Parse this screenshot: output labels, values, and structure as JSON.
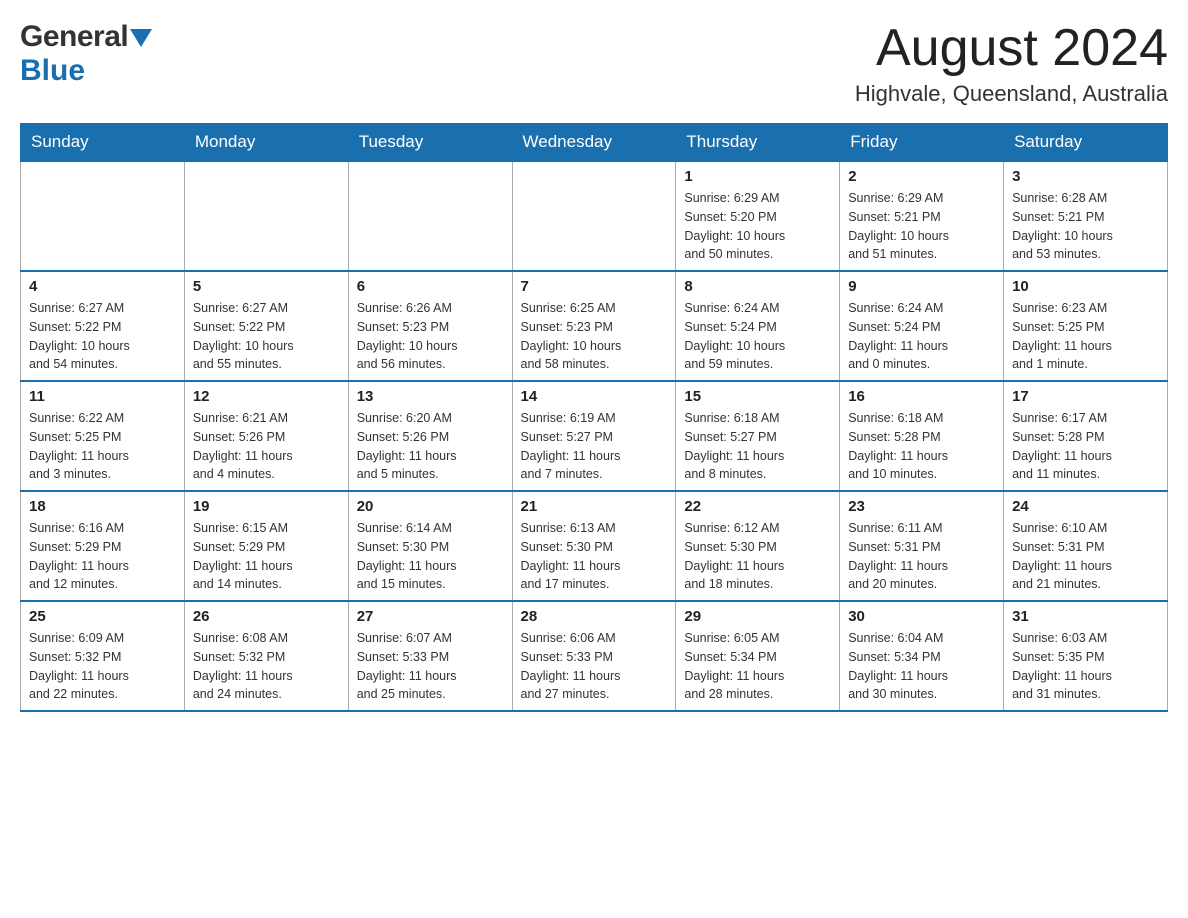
{
  "header": {
    "logo_general": "General",
    "logo_blue": "Blue",
    "month_title": "August 2024",
    "location": "Highvale, Queensland, Australia"
  },
  "days_of_week": [
    "Sunday",
    "Monday",
    "Tuesday",
    "Wednesday",
    "Thursday",
    "Friday",
    "Saturday"
  ],
  "weeks": [
    [
      {
        "day": "",
        "info": ""
      },
      {
        "day": "",
        "info": ""
      },
      {
        "day": "",
        "info": ""
      },
      {
        "day": "",
        "info": ""
      },
      {
        "day": "1",
        "info": "Sunrise: 6:29 AM\nSunset: 5:20 PM\nDaylight: 10 hours\nand 50 minutes."
      },
      {
        "day": "2",
        "info": "Sunrise: 6:29 AM\nSunset: 5:21 PM\nDaylight: 10 hours\nand 51 minutes."
      },
      {
        "day": "3",
        "info": "Sunrise: 6:28 AM\nSunset: 5:21 PM\nDaylight: 10 hours\nand 53 minutes."
      }
    ],
    [
      {
        "day": "4",
        "info": "Sunrise: 6:27 AM\nSunset: 5:22 PM\nDaylight: 10 hours\nand 54 minutes."
      },
      {
        "day": "5",
        "info": "Sunrise: 6:27 AM\nSunset: 5:22 PM\nDaylight: 10 hours\nand 55 minutes."
      },
      {
        "day": "6",
        "info": "Sunrise: 6:26 AM\nSunset: 5:23 PM\nDaylight: 10 hours\nand 56 minutes."
      },
      {
        "day": "7",
        "info": "Sunrise: 6:25 AM\nSunset: 5:23 PM\nDaylight: 10 hours\nand 58 minutes."
      },
      {
        "day": "8",
        "info": "Sunrise: 6:24 AM\nSunset: 5:24 PM\nDaylight: 10 hours\nand 59 minutes."
      },
      {
        "day": "9",
        "info": "Sunrise: 6:24 AM\nSunset: 5:24 PM\nDaylight: 11 hours\nand 0 minutes."
      },
      {
        "day": "10",
        "info": "Sunrise: 6:23 AM\nSunset: 5:25 PM\nDaylight: 11 hours\nand 1 minute."
      }
    ],
    [
      {
        "day": "11",
        "info": "Sunrise: 6:22 AM\nSunset: 5:25 PM\nDaylight: 11 hours\nand 3 minutes."
      },
      {
        "day": "12",
        "info": "Sunrise: 6:21 AM\nSunset: 5:26 PM\nDaylight: 11 hours\nand 4 minutes."
      },
      {
        "day": "13",
        "info": "Sunrise: 6:20 AM\nSunset: 5:26 PM\nDaylight: 11 hours\nand 5 minutes."
      },
      {
        "day": "14",
        "info": "Sunrise: 6:19 AM\nSunset: 5:27 PM\nDaylight: 11 hours\nand 7 minutes."
      },
      {
        "day": "15",
        "info": "Sunrise: 6:18 AM\nSunset: 5:27 PM\nDaylight: 11 hours\nand 8 minutes."
      },
      {
        "day": "16",
        "info": "Sunrise: 6:18 AM\nSunset: 5:28 PM\nDaylight: 11 hours\nand 10 minutes."
      },
      {
        "day": "17",
        "info": "Sunrise: 6:17 AM\nSunset: 5:28 PM\nDaylight: 11 hours\nand 11 minutes."
      }
    ],
    [
      {
        "day": "18",
        "info": "Sunrise: 6:16 AM\nSunset: 5:29 PM\nDaylight: 11 hours\nand 12 minutes."
      },
      {
        "day": "19",
        "info": "Sunrise: 6:15 AM\nSunset: 5:29 PM\nDaylight: 11 hours\nand 14 minutes."
      },
      {
        "day": "20",
        "info": "Sunrise: 6:14 AM\nSunset: 5:30 PM\nDaylight: 11 hours\nand 15 minutes."
      },
      {
        "day": "21",
        "info": "Sunrise: 6:13 AM\nSunset: 5:30 PM\nDaylight: 11 hours\nand 17 minutes."
      },
      {
        "day": "22",
        "info": "Sunrise: 6:12 AM\nSunset: 5:30 PM\nDaylight: 11 hours\nand 18 minutes."
      },
      {
        "day": "23",
        "info": "Sunrise: 6:11 AM\nSunset: 5:31 PM\nDaylight: 11 hours\nand 20 minutes."
      },
      {
        "day": "24",
        "info": "Sunrise: 6:10 AM\nSunset: 5:31 PM\nDaylight: 11 hours\nand 21 minutes."
      }
    ],
    [
      {
        "day": "25",
        "info": "Sunrise: 6:09 AM\nSunset: 5:32 PM\nDaylight: 11 hours\nand 22 minutes."
      },
      {
        "day": "26",
        "info": "Sunrise: 6:08 AM\nSunset: 5:32 PM\nDaylight: 11 hours\nand 24 minutes."
      },
      {
        "day": "27",
        "info": "Sunrise: 6:07 AM\nSunset: 5:33 PM\nDaylight: 11 hours\nand 25 minutes."
      },
      {
        "day": "28",
        "info": "Sunrise: 6:06 AM\nSunset: 5:33 PM\nDaylight: 11 hours\nand 27 minutes."
      },
      {
        "day": "29",
        "info": "Sunrise: 6:05 AM\nSunset: 5:34 PM\nDaylight: 11 hours\nand 28 minutes."
      },
      {
        "day": "30",
        "info": "Sunrise: 6:04 AM\nSunset: 5:34 PM\nDaylight: 11 hours\nand 30 minutes."
      },
      {
        "day": "31",
        "info": "Sunrise: 6:03 AM\nSunset: 5:35 PM\nDaylight: 11 hours\nand 31 minutes."
      }
    ]
  ]
}
